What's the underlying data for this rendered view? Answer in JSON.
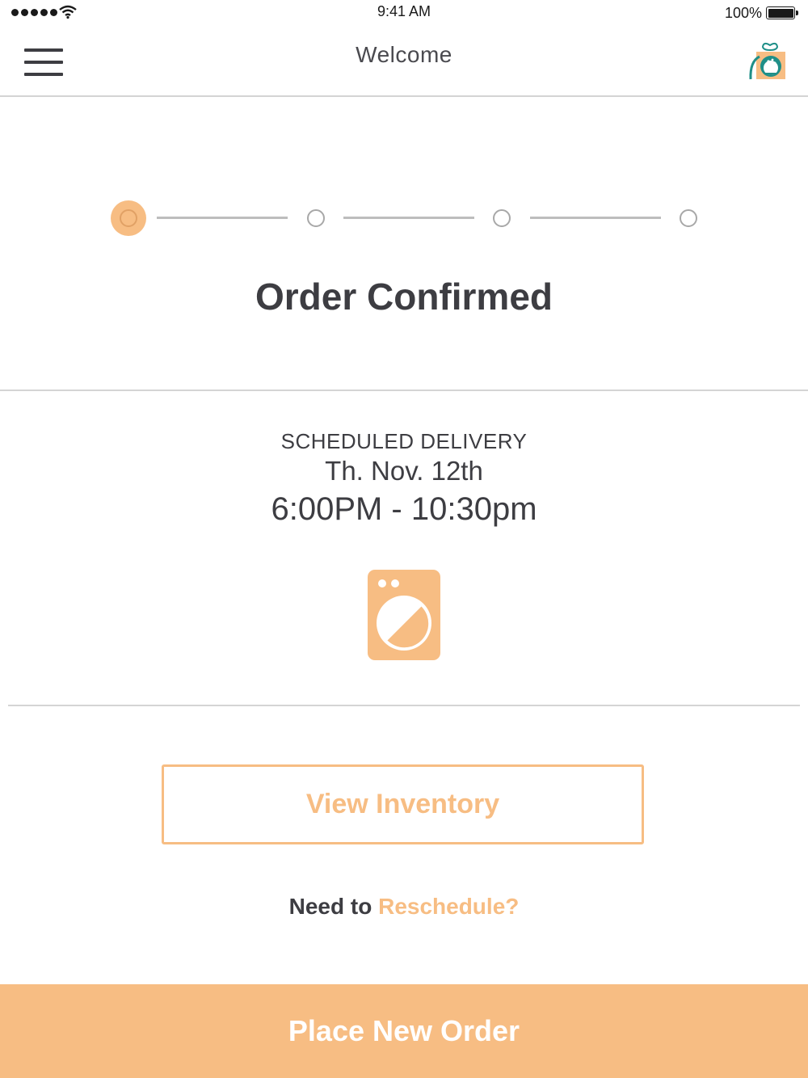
{
  "status_bar": {
    "time": "9:41 AM",
    "battery": "100%",
    "battery_level": 1.0,
    "signal_bars": 5
  },
  "navbar": {
    "title": "Welcome",
    "menu_icon": "hamburger-menu-icon",
    "logo_icon": "laundry-gift-logo-icon"
  },
  "progress": {
    "total_steps": 4,
    "current_step": 1
  },
  "order": {
    "status_title": "Order Confirmed"
  },
  "delivery": {
    "label": "SCHEDULED DELIVERY",
    "date": "Th. Nov. 12th",
    "time_window": "6:00PM - 10:30pm",
    "icon": "washing-machine-icon"
  },
  "actions": {
    "view_inventory_label": "View Inventory",
    "reschedule_prefix": "Need to",
    "reschedule_link": "Reschedule?",
    "place_order_label": "Place New Order"
  },
  "colors": {
    "accent": "#f7bd83",
    "text": "#3d3d42",
    "divider": "#d4d4d4",
    "teal": "#1f8f88"
  }
}
